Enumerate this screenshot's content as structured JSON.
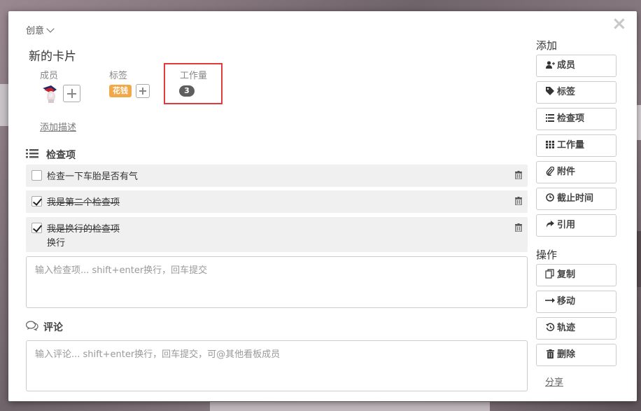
{
  "list": {
    "name": "创意"
  },
  "card": {
    "title": "新的卡片"
  },
  "fields": {
    "members_label": "成员",
    "labels_label": "标签",
    "workload_label": "工作量",
    "label_chip": "花钱",
    "workload_value": "3",
    "add_description": "添加描述"
  },
  "checklist": {
    "title": "检查项",
    "items": [
      {
        "text": "检查一下车胎是否有气",
        "checked": false
      },
      {
        "text": "我是第二个检查项",
        "checked": true
      },
      {
        "text": "我是换行的检查项",
        "text_line2": "换行",
        "checked": true
      }
    ],
    "input_placeholder": "输入检查项... shift+enter换行，回车提交"
  },
  "comments": {
    "title": "评论",
    "input_placeholder": "输入评论... shift+enter换行，回车提交，可@其他看板成员"
  },
  "sidebar": {
    "add_heading": "添加",
    "add_buttons": [
      "成员",
      "标签",
      "检查项",
      "工作量",
      "附件",
      "截止时间",
      "引用"
    ],
    "ops_heading": "操作",
    "op_buttons": [
      "复制",
      "移动",
      "轨迹",
      "删除"
    ],
    "share": "分享"
  },
  "colors": {
    "label_orange": "#f0a849",
    "highlight_red": "#e03a3a",
    "badge_gray": "#5e5e5e"
  }
}
